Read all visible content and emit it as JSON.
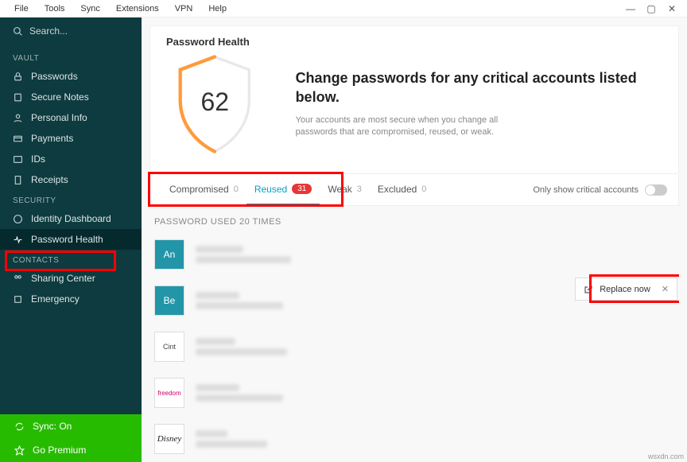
{
  "menubar": [
    "File",
    "Tools",
    "Sync",
    "Extensions",
    "VPN",
    "Help"
  ],
  "search": {
    "placeholder": "Search..."
  },
  "sidebar": {
    "vault_title": "VAULT",
    "vault": [
      {
        "label": "Passwords"
      },
      {
        "label": "Secure Notes"
      },
      {
        "label": "Personal Info"
      },
      {
        "label": "Payments"
      },
      {
        "label": "IDs"
      },
      {
        "label": "Receipts"
      }
    ],
    "security_title": "SECURITY",
    "security": [
      {
        "label": "Identity Dashboard"
      },
      {
        "label": "Password Health"
      }
    ],
    "contacts_title": "CONTACTS",
    "contacts": [
      {
        "label": "Sharing Center"
      },
      {
        "label": "Emergency"
      }
    ]
  },
  "footer": {
    "sync": "Sync: On",
    "premium": "Go Premium"
  },
  "hero": {
    "title": "Password Health",
    "score": "62",
    "heading": "Change passwords for any critical accounts listed below.",
    "sub": "Your accounts are most secure when you change all passwords that are compromised, reused, or weak."
  },
  "tabs": {
    "compromised": {
      "label": "Compromised",
      "count": "0"
    },
    "reused": {
      "label": "Reused",
      "count": "31"
    },
    "weak": {
      "label": "Weak",
      "count": "3"
    },
    "excluded": {
      "label": "Excluded",
      "count": "0"
    },
    "critical_label": "Only show critical accounts"
  },
  "list": {
    "title": "PASSWORD USED 20 TIMES",
    "items": [
      {
        "tile": "An",
        "cls": "an"
      },
      {
        "tile": "Be",
        "cls": "be"
      },
      {
        "tile": "Cint",
        "cls": "cint"
      },
      {
        "tile": "freedom",
        "cls": "free"
      },
      {
        "tile": "Disney",
        "cls": "dis"
      }
    ]
  },
  "replace_now": "Replace now",
  "watermark": "wsxdn.com"
}
